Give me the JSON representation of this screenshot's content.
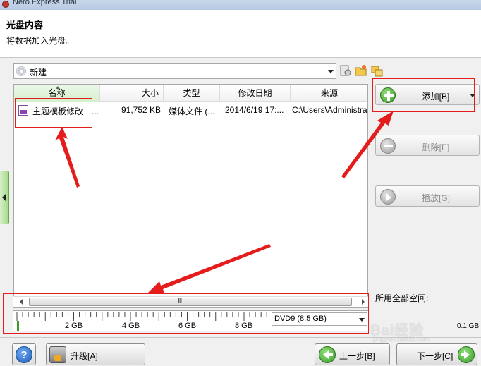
{
  "window": {
    "title": "Nero Express Trial"
  },
  "header": {
    "title": "光盘内容",
    "subtitle": "将数据加入光盘。"
  },
  "compilation": {
    "name": "新建"
  },
  "table": {
    "columns": [
      "名称",
      "大小",
      "类型",
      "修改日期",
      "来源"
    ],
    "rows": [
      {
        "name": "主题模板修改一...",
        "size": "91,752 KB",
        "type": "媒体文件 (...",
        "date": "2014/6/19 17:...",
        "source": "C:\\Users\\Administra"
      }
    ]
  },
  "scrollbar": {
    "grip": "III"
  },
  "capacity": {
    "scale_labels": [
      "2 GB",
      "4 GB",
      "6 GB",
      "8 GB"
    ],
    "disk_type": "DVD9 (8.5 GB)",
    "total_space_label": "所用全部空间:",
    "total_space_value": "0.1 GB"
  },
  "buttons": {
    "add": "添加[B]",
    "delete": "删除[E]",
    "play": "播放[G]",
    "help": "?",
    "upgrade": "升级[A]",
    "back": "上一步[B]",
    "next": "下一步[C]"
  },
  "watermark": {
    "text": "Bai经验",
    "sub": "jingyan.baidu.com"
  },
  "colors": {
    "annotation_red": "#e51c1c",
    "accent_green": "#3f9a2c"
  }
}
